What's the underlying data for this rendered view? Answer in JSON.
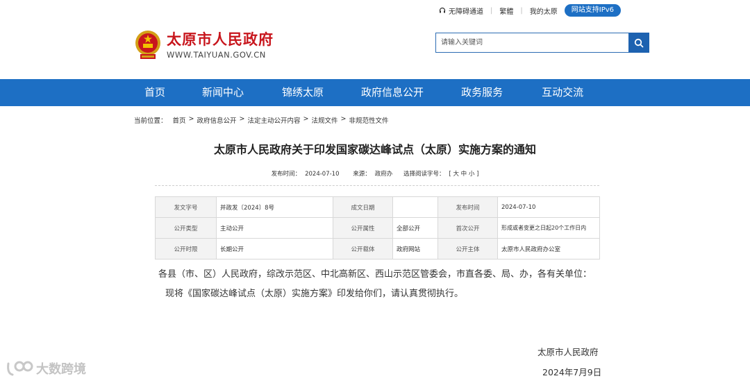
{
  "topbar": {
    "accessible_label": "无障碍通道",
    "traditional_label": "繁體",
    "my_taiyuan_label": "我的太原",
    "ipv6_label": "网站支持IPv6"
  },
  "logo": {
    "title": "太原市人民政府",
    "url": "WWW.TAIYUAN.GOV.CN"
  },
  "search": {
    "placeholder": "请输入关键词"
  },
  "nav": {
    "items": [
      "首页",
      "新闻中心",
      "锦绣太原",
      "政府信息公开",
      "政务服务",
      "互动交流"
    ]
  },
  "breadcrumb": {
    "prefix": "当前位置：",
    "items": [
      "首页",
      "政府信息公开",
      "法定主动公开内容",
      "法规文件",
      "非规范性文件"
    ]
  },
  "article": {
    "title": "太原市人民政府关于印发国家碳达峰试点（太原）实施方案的通知",
    "meta": {
      "publish_label": "发布时间：",
      "publish_value": "2024-07-10",
      "source_label": "来源：",
      "source_value": "政府办",
      "fontsize_label": "选择阅读字号：",
      "fontsize_options": "[ 大  中  小 ]"
    },
    "info": {
      "rows": [
        [
          "发文字号",
          "并政发〔2024〕8号",
          "成文日期",
          "",
          "发布时间",
          "2024-07-10"
        ],
        [
          "公开类型",
          "主动公开",
          "公开属性",
          "全部公开",
          "首次公开",
          "形成或者变更之日起20个工作日内"
        ],
        [
          "公开时限",
          "长期公开",
          "公开载体",
          "政府网站",
          "公开主体",
          "太原市人民政府办公室"
        ]
      ]
    },
    "paragraph1": "各县（市、区）人民政府，综改示范区、中北高新区、西山示范区管委会，市直各委、局、办，各有关单位：",
    "paragraph2": "现将《国家碳达峰试点（太原）实施方案》印发给你们，请认真贯彻执行。",
    "signer": "太原市人民政府",
    "date": "2024年7月9日"
  },
  "watermark": {
    "text": "大数跨境"
  },
  "colors": {
    "brand_blue": "#1d6fc4",
    "title_red": "#c8161d"
  }
}
